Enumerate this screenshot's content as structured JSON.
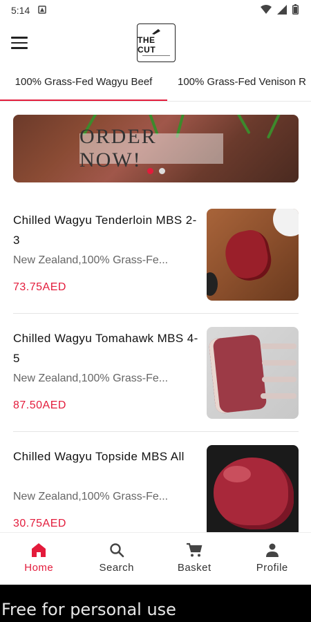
{
  "status_bar": {
    "time": "5:14"
  },
  "app_bar": {
    "logo_text": "THE CUT"
  },
  "tabs": [
    {
      "label": "100% Grass-Fed Wagyu Beef",
      "active": true
    },
    {
      "label": "100% Grass-Fed Venison R",
      "active": false
    }
  ],
  "banner": {
    "text": "ORDER NOW!",
    "slides": 2,
    "active_slide": 1
  },
  "products": [
    {
      "name": "Chilled Wagyu Tenderloin MBS 2-3",
      "origin": "New Zealand,100% Grass-Fe...",
      "price": "73.75AED",
      "image": "tenderloin-photo"
    },
    {
      "name": "Chilled Wagyu Tomahawk MBS 4-5",
      "origin": "New Zealand,100% Grass-Fe...",
      "price": "87.50AED",
      "image": "tomahawk-photo"
    },
    {
      "name": "Chilled Wagyu Topside MBS All",
      "origin": "New Zealand,100% Grass-Fe...",
      "price": "30.75AED",
      "image": "topside-photo"
    }
  ],
  "bottom_nav": [
    {
      "label": "Home",
      "icon": "home-icon",
      "active": true
    },
    {
      "label": "Search",
      "icon": "search-icon",
      "active": false
    },
    {
      "label": "Basket",
      "icon": "cart-icon",
      "active": false
    },
    {
      "label": "Profile",
      "icon": "person-icon",
      "active": false
    }
  ],
  "watermark": "Free for personal use",
  "colors": {
    "accent": "#e31b3b"
  }
}
